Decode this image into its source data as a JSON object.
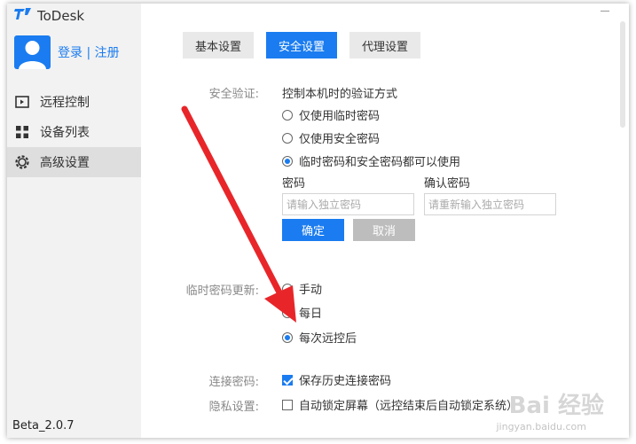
{
  "app": {
    "title": "ToDesk",
    "version": "Beta_2.0.7"
  },
  "user": {
    "login_label": "登录 | 注册"
  },
  "sidebar": {
    "items": [
      {
        "label": "远程控制",
        "icon": "remote-control-icon"
      },
      {
        "label": "设备列表",
        "icon": "grid-icon"
      },
      {
        "label": "高级设置",
        "icon": "gear-icon",
        "active": true
      }
    ]
  },
  "tabs": [
    {
      "label": "基本设置"
    },
    {
      "label": "安全设置",
      "active": true
    },
    {
      "label": "代理设置"
    }
  ],
  "security": {
    "label": "安全验证:",
    "description": "控制本机时的验证方式",
    "options": [
      {
        "label": "仅使用临时密码",
        "selected": false
      },
      {
        "label": "仅使用安全密码",
        "selected": false
      },
      {
        "label": "临时密码和安全密码都可以使用",
        "selected": true
      }
    ],
    "password_label": "密码",
    "password_placeholder": "请输入独立密码",
    "confirm_label": "确认密码",
    "confirm_placeholder": "请重新输入独立密码",
    "ok_label": "确定",
    "cancel_label": "取消"
  },
  "temp_update": {
    "label": "临时密码更新:",
    "options": [
      {
        "label": "手动",
        "selected": false
      },
      {
        "label": "每日",
        "selected": false
      },
      {
        "label": "每次远控后",
        "selected": true
      }
    ]
  },
  "conn_password": {
    "label": "连接密码:",
    "checkbox_label": "保存历史连接密码",
    "checked": true
  },
  "privacy": {
    "label": "隐私设置:",
    "checkbox_label": "自动锁定屏幕（远控结束后自动锁定系统）",
    "checked": false
  },
  "watermark": {
    "text": "Bai 经验",
    "sub": "jingyan.baidu.com"
  },
  "colors": {
    "accent": "#1a7cf0",
    "annotation": "#e8262a",
    "sidebar_bg": "#f2f2f2"
  }
}
